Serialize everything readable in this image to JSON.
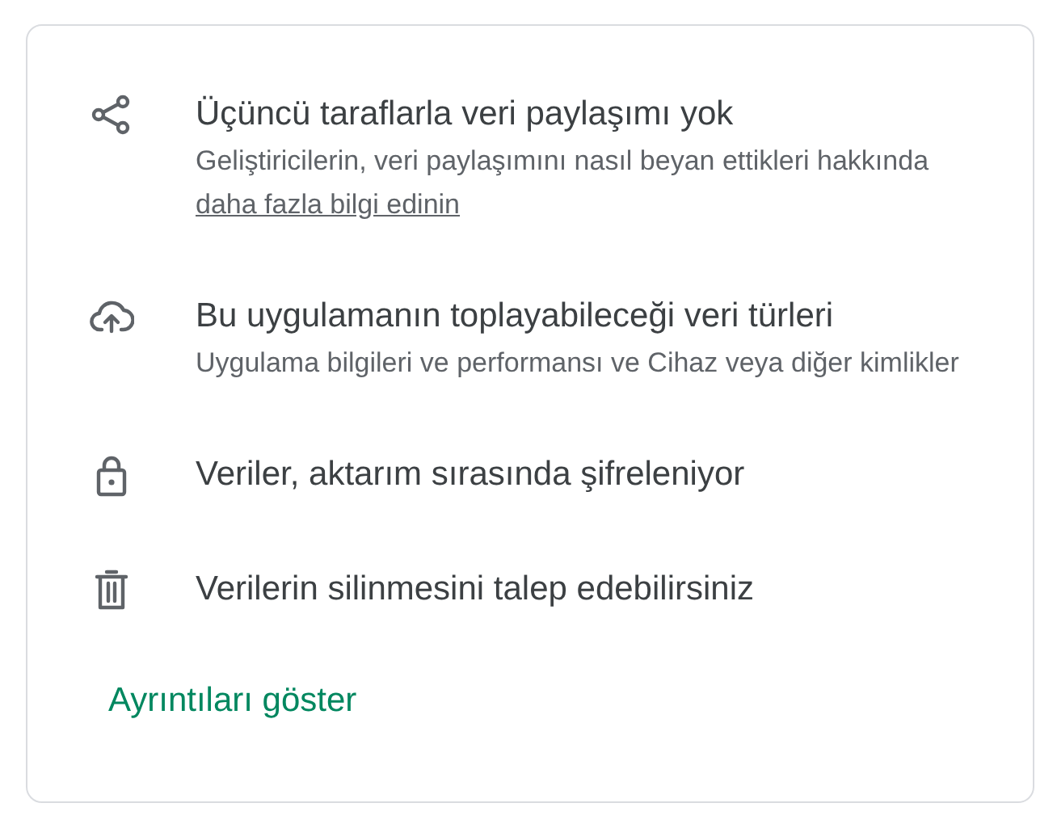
{
  "items": [
    {
      "kind": "share",
      "title": "Üçüncü taraflarla veri paylaşımı yok",
      "description": "Geliştiricilerin, veri paylaşımını nasıl beyan ettikleri hakkında",
      "link": "daha fazla bilgi edinin"
    },
    {
      "kind": "cloud-upload",
      "title": "Bu uygulamanın toplayabileceği veri türleri",
      "description": "Uygulama bilgileri ve performansı ve Cihaz veya diğer kimlikler"
    },
    {
      "kind": "lock",
      "title": "Veriler, aktarım sırasında şifreleniyor"
    },
    {
      "kind": "trash",
      "title": "Verilerin silinmesini talep edebilirsiniz"
    }
  ],
  "details_link": "Ayrıntıları göster"
}
